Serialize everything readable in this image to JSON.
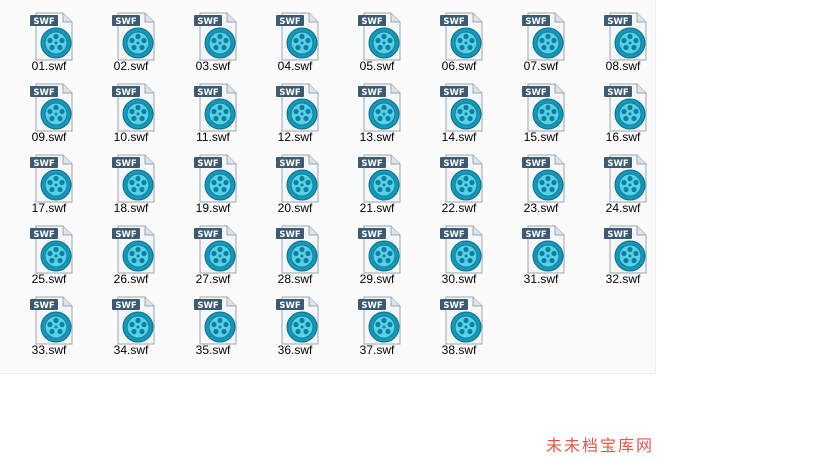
{
  "file_type_badge": "SWF",
  "icon": "swf-film-reel-icon",
  "files": [
    "01.swf",
    "02.swf",
    "03.swf",
    "04.swf",
    "05.swf",
    "06.swf",
    "07.swf",
    "08.swf",
    "09.swf",
    "10.swf",
    "11.swf",
    "12.swf",
    "13.swf",
    "14.swf",
    "15.swf",
    "16.swf",
    "17.swf",
    "18.swf",
    "19.swf",
    "20.swf",
    "21.swf",
    "22.swf",
    "23.swf",
    "24.swf",
    "25.swf",
    "26.swf",
    "27.swf",
    "28.swf",
    "29.swf",
    "30.swf",
    "31.swf",
    "32.swf",
    "33.swf",
    "34.swf",
    "35.swf",
    "36.swf",
    "37.swf",
    "38.swf"
  ],
  "watermark": "未未档宝库网",
  "colors": {
    "badge": "#3e5a73",
    "reel_outer": "#1597b8",
    "reel_inner": "#59d0ea",
    "watermark": "#e03a2e"
  }
}
